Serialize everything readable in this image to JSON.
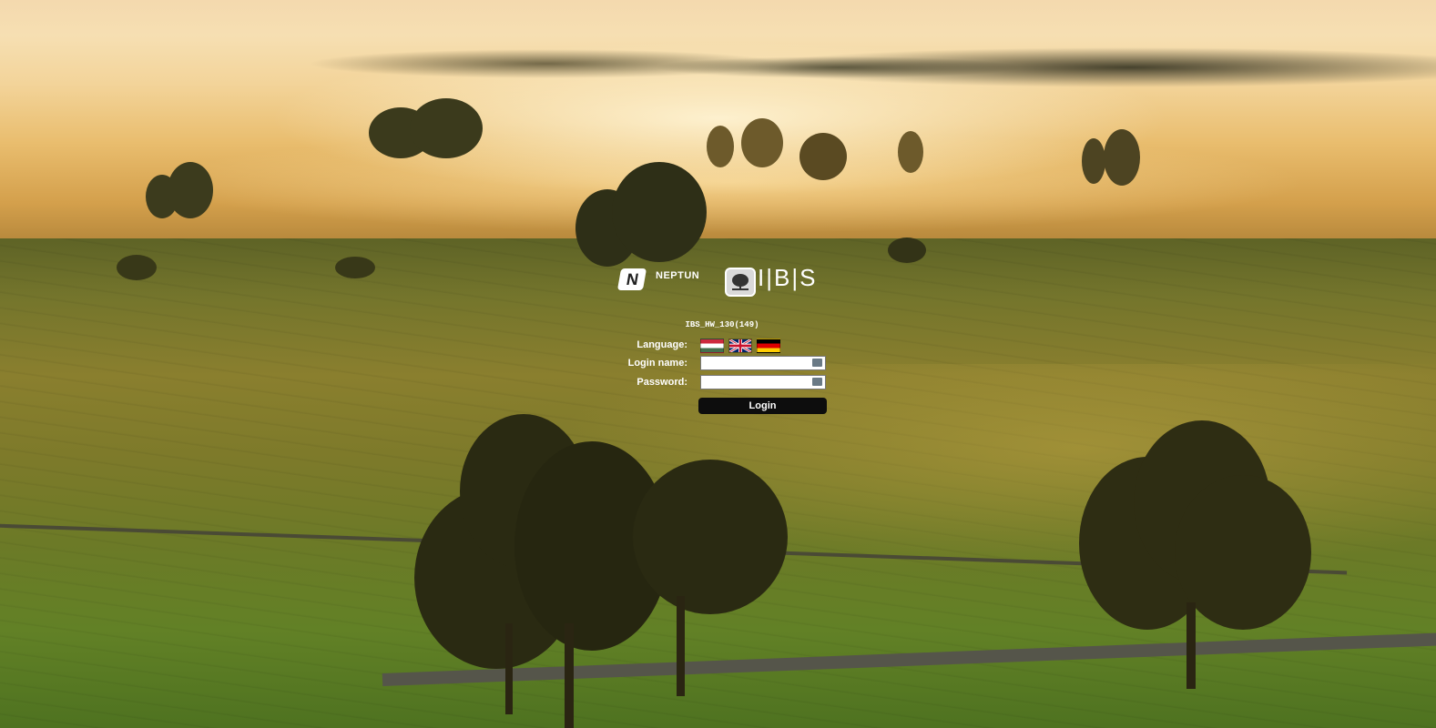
{
  "branding": {
    "neptun_mark": "N",
    "neptun_name": "NEPTUN",
    "ibs_name": "I|B|S"
  },
  "server": {
    "name": "IBS_HW_130(149)"
  },
  "login_form": {
    "language_label": "Language:",
    "languages": [
      {
        "code": "hu",
        "icon": "hungarian-flag-icon"
      },
      {
        "code": "en",
        "icon": "uk-flag-icon"
      },
      {
        "code": "de",
        "icon": "german-flag-icon"
      }
    ],
    "login_name_label": "Login name:",
    "login_name_value": "",
    "password_label": "Password:",
    "password_value": "",
    "virtual_keyboard_icon": "keyboard-icon",
    "login_button_label": "Login"
  },
  "colors": {
    "button_bg": "#0d0d0d",
    "label_text": "#ffffff"
  }
}
